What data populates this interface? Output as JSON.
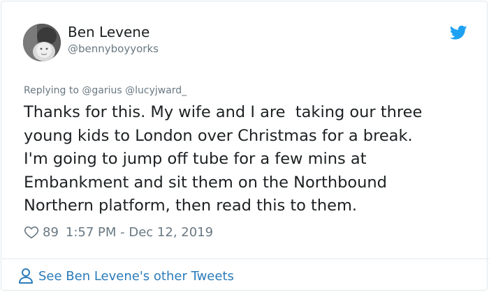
{
  "tweet": {
    "author_name": "Ben Levene",
    "author_handle": "@bennyboyyorks",
    "replying_prefix": "Replying to",
    "replying_mentions": [
      "@garius",
      "@lucyjward_"
    ],
    "text_lines": [
      "Thanks for this. My wife and I are  taking our three",
      "young kids to London over Christmas for a break.",
      "I'm going to jump off tube for a few mins at",
      "Embankment and sit them on the Northbound",
      "Northern platform, then read this to them."
    ],
    "likes": "89",
    "timestamp": "1:57 PM - Dec 12, 2019"
  },
  "footer": {
    "see_more_label": "See Ben Levene's other Tweets"
  },
  "icons": {
    "brand": "twitter-bird-icon",
    "like": "heart-icon",
    "profile": "person-icon"
  },
  "colors": {
    "brand_blue": "#1da1f2",
    "link_blue": "#2b7bb9",
    "text": "#1c2022",
    "muted": "#697882",
    "border": "#e1e8ed"
  }
}
